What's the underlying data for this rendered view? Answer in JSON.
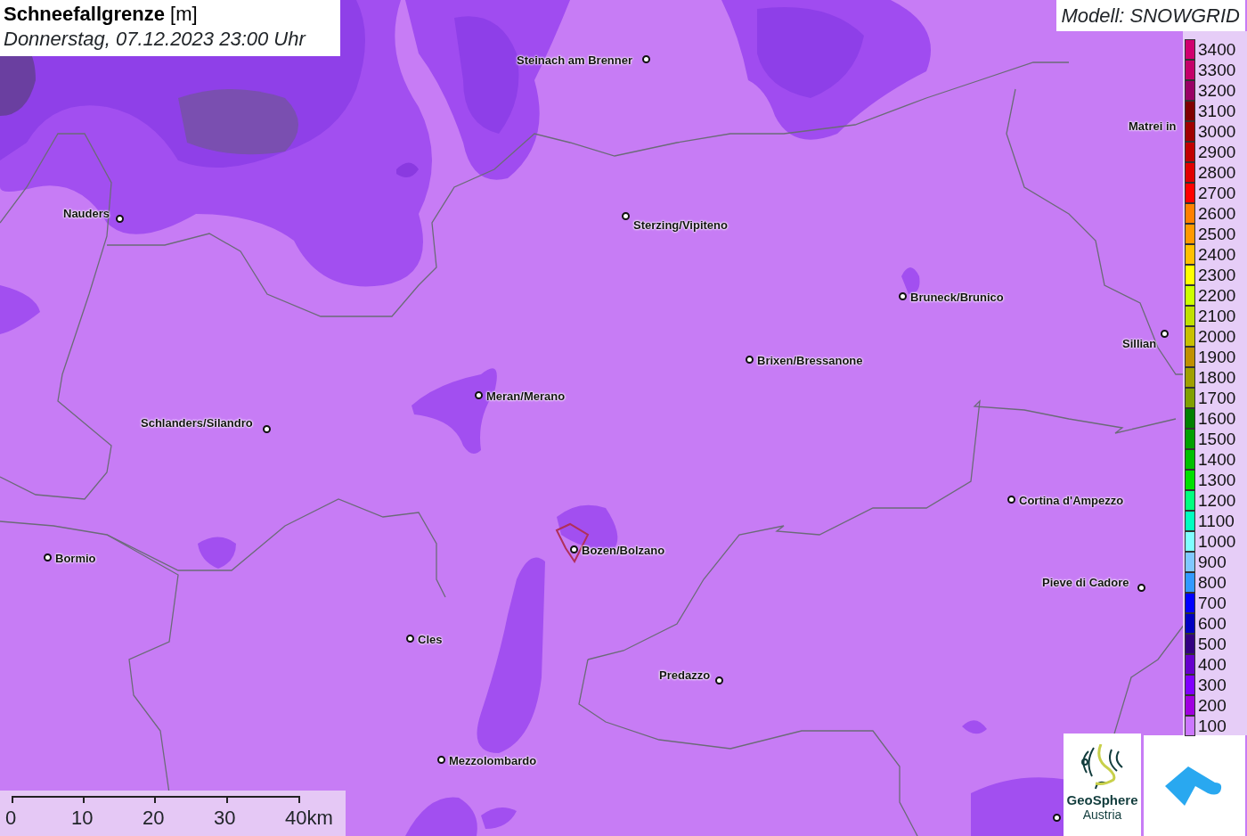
{
  "title": {
    "main": "Schneefallgrenze",
    "unit": "[m]",
    "subtitle": "Donnerstag, 07.12.2023 23:00 Uhr"
  },
  "model": "Modell: SNOWGRID",
  "legend": [
    {
      "label": "3400",
      "color": "#d0006f"
    },
    {
      "label": "3300",
      "color": "#c4006a"
    },
    {
      "label": "3200",
      "color": "#990066"
    },
    {
      "label": "3100",
      "color": "#800000"
    },
    {
      "label": "3000",
      "color": "#a00000"
    },
    {
      "label": "2900",
      "color": "#c00000"
    },
    {
      "label": "2800",
      "color": "#e00000"
    },
    {
      "label": "2700",
      "color": "#ff0000"
    },
    {
      "label": "2600",
      "color": "#ff8000"
    },
    {
      "label": "2500",
      "color": "#ff9900"
    },
    {
      "label": "2400",
      "color": "#ffc000"
    },
    {
      "label": "2300",
      "color": "#ffff00"
    },
    {
      "label": "2200",
      "color": "#ccff00"
    },
    {
      "label": "2100",
      "color": "#c0e000"
    },
    {
      "label": "2000",
      "color": "#c8c000"
    },
    {
      "label": "1900",
      "color": "#c09000"
    },
    {
      "label": "1800",
      "color": "#a0a000"
    },
    {
      "label": "1700",
      "color": "#80a000"
    },
    {
      "label": "1600",
      "color": "#008000"
    },
    {
      "label": "1500",
      "color": "#00a000"
    },
    {
      "label": "1400",
      "color": "#00c000"
    },
    {
      "label": "1300",
      "color": "#00e000"
    },
    {
      "label": "1200",
      "color": "#00ff80"
    },
    {
      "label": "1100",
      "color": "#00ffc0"
    },
    {
      "label": "1000",
      "color": "#80ffff"
    },
    {
      "label": "900",
      "color": "#80c8ff"
    },
    {
      "label": "800",
      "color": "#3399ff"
    },
    {
      "label": "700",
      "color": "#0000ff"
    },
    {
      "label": "600",
      "color": "#0000c0"
    },
    {
      "label": "500",
      "color": "#330080"
    },
    {
      "label": "400",
      "color": "#6600cc"
    },
    {
      "label": "300",
      "color": "#8000ff"
    },
    {
      "label": "200",
      "color": "#a000e0"
    },
    {
      "label": "100",
      "color": "#cc77ff"
    }
  ],
  "cities": [
    "Steinach am Brenner",
    "Nauders",
    "Sterzing/Vipiteno",
    "Matrei in",
    "Bruneck/Brunico",
    "Sillian",
    "Brixen/Bressanone",
    "Meran/Merano",
    "Schlanders/Silandro",
    "Cortina d'Ampezzo",
    "Bormio",
    "Bozen/Bolzano",
    "Pieve di Cadore",
    "Cles",
    "Predazzo",
    "Mezzolombardo"
  ],
  "scale": [
    "0",
    "10",
    "20",
    "30",
    "40km"
  ],
  "logo": {
    "name": "GeoSphere",
    "country": "Austria"
  }
}
